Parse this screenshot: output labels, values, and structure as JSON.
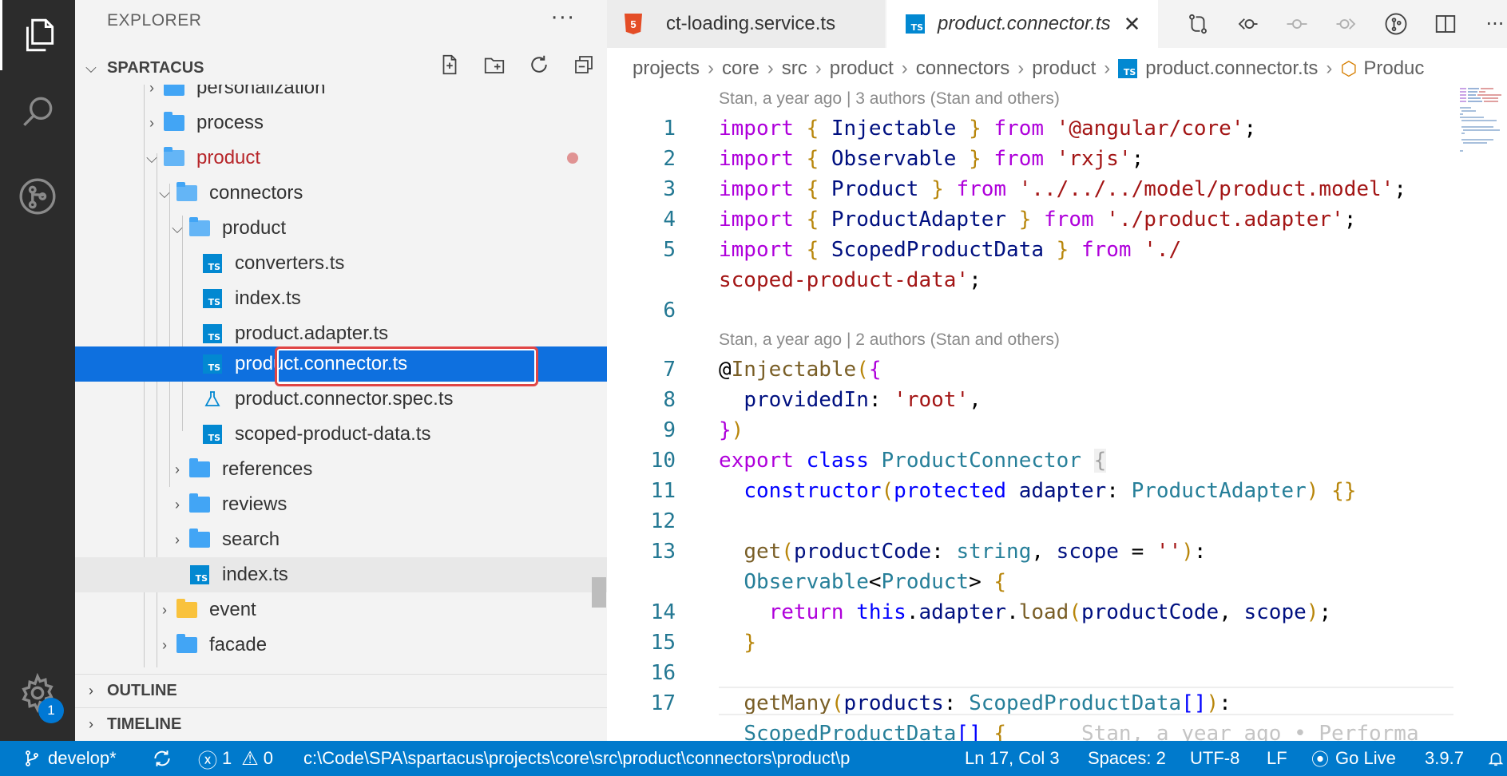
{
  "activity_bar": {
    "settings_badge": "1"
  },
  "sidebar": {
    "title": "EXPLORER",
    "more": "···",
    "workspace": "SPARTACUS",
    "tree": [
      {
        "label": "personalization"
      },
      {
        "label": "process"
      },
      {
        "label": "product"
      },
      {
        "label": "connectors"
      },
      {
        "label": "product"
      },
      {
        "label": "converters.ts"
      },
      {
        "label": "index.ts"
      },
      {
        "label": "product.adapter.ts"
      },
      {
        "label": "product.connector.ts"
      },
      {
        "label": "product.connector.spec.ts"
      },
      {
        "label": "scoped-product-data.ts"
      },
      {
        "label": "references"
      },
      {
        "label": "reviews"
      },
      {
        "label": "search"
      },
      {
        "label": "index.ts"
      },
      {
        "label": "event"
      },
      {
        "label": "facade"
      }
    ],
    "outline": "OUTLINE",
    "timeline": "TIMELINE"
  },
  "tabs": [
    {
      "label": "ct-loading.service.ts",
      "icon": "html5-icon"
    },
    {
      "label": "product.connector.ts",
      "icon": "typescript-icon"
    }
  ],
  "breadcrumbs": [
    "projects",
    "core",
    "src",
    "product",
    "connectors",
    "product",
    "product.connector.ts",
    "Produc"
  ],
  "code": {
    "lens1": "Stan, a year ago | 3 authors (Stan and others)",
    "lens2": "Stan, a year ago | 2 authors (Stan and others)",
    "line_numbers": [
      "1",
      "2",
      "3",
      "4",
      "5",
      "6",
      "7",
      "8",
      "9",
      "10",
      "11",
      "12",
      "13",
      "14",
      "15",
      "16",
      "17"
    ],
    "blame": "Stan, a year ago • Performa"
  },
  "status_bar": {
    "branch": "develop*",
    "errors": "1",
    "warnings": "0",
    "path": "c:\\Code\\SPA\\spartacus\\projects\\core\\src\\product\\connectors\\product\\p",
    "position": "Ln 17, Col 3",
    "spaces": "Spaces: 2",
    "encoding": "UTF-8",
    "eol": "LF",
    "golive": "Go Live",
    "version": "3.9.7"
  },
  "colors": {
    "activity_bg": "#2c2c2c",
    "selection": "#0e70df",
    "status_bg": "#007acc"
  }
}
